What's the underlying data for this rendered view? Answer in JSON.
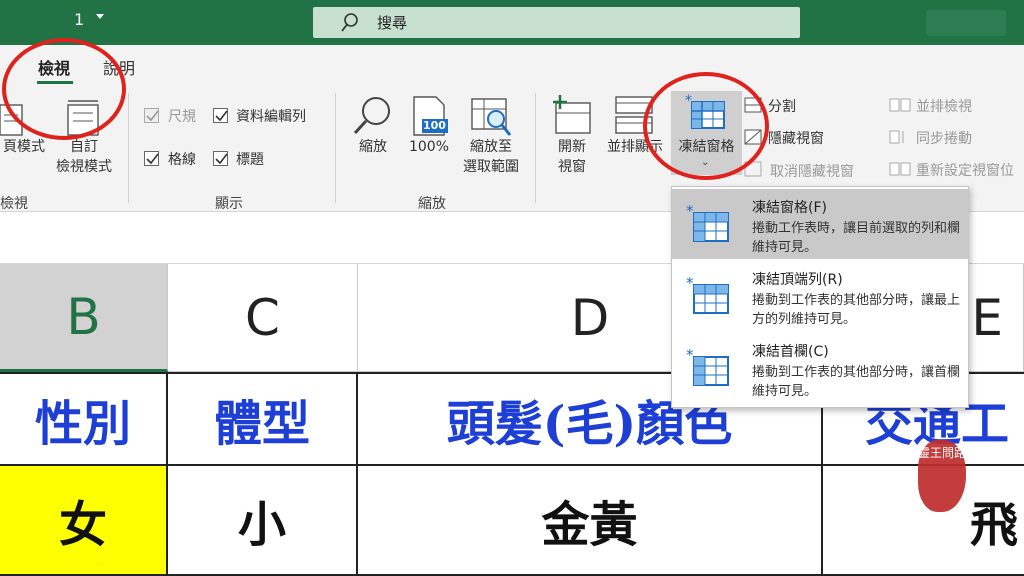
{
  "titlebar": {
    "qat_number": "1",
    "search_label": "搜尋"
  },
  "tabs": {
    "view": "檢視",
    "help": "說明"
  },
  "groups": {
    "workbook_views": {
      "label": "檢視",
      "page_layout": "頁模式",
      "custom_views_1": "自訂",
      "custom_views_2": "檢視模式"
    },
    "show": {
      "label": "顯示",
      "ruler": "尺規",
      "formula_bar": "資料編輯列",
      "gridlines": "格線",
      "headings": "標題"
    },
    "zoom": {
      "label": "縮放",
      "zoom": "縮放",
      "zoom_100": "100%",
      "zoom_selection_1": "縮放至",
      "zoom_selection_2": "選取範圍",
      "icon_100": "100"
    },
    "window": {
      "new_window_1": "開新",
      "new_window_2": "視窗",
      "arrange_all": "並排顯示",
      "freeze_panes": "凍結窗格",
      "split": "分割",
      "hide": "隱藏視窗",
      "unhide": "取消隱藏視窗",
      "view_side_by_side": "並排檢視",
      "sync_scroll": "同步捲動",
      "reset_position": "重新設定視窗位"
    }
  },
  "freeze_menu": [
    {
      "title": "凍結窗格(F)",
      "desc": "捲動工作表時，讓目前選取的列和欄維持可見。"
    },
    {
      "title": "凍結頂端列(R)",
      "desc": "捲動到工作表的其他部分時，讓最上方的列維持可見。"
    },
    {
      "title": "凍結首欄(C)",
      "desc": "捲動到工作表的其他部分時，讓首欄維持可見。"
    }
  ],
  "sheet": {
    "columns": [
      "B",
      "C",
      "D",
      "E"
    ],
    "header_row": [
      "性別",
      "體型",
      "頭髮(毛)顏色",
      "交通工"
    ],
    "data_row": [
      "女",
      "小",
      "金黃",
      "飛"
    ]
  },
  "seal_text": "靈王問路",
  "colors": {
    "accent": "#217346",
    "header_text": "#1d3fd6",
    "highlight_yellow": "#ffff00",
    "annotation_red": "#e0211c"
  }
}
